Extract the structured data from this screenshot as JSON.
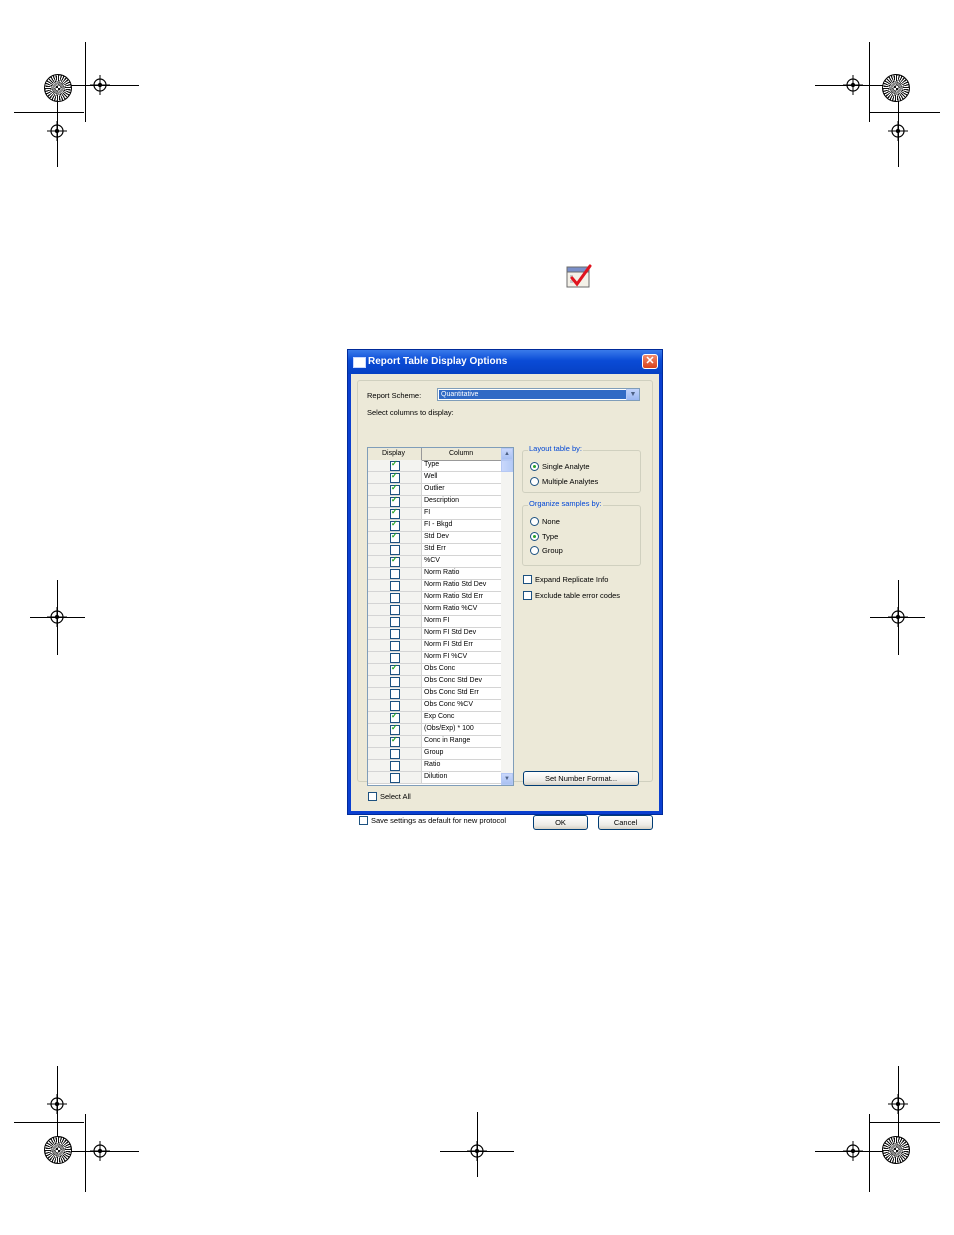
{
  "dialog": {
    "title": "Report Table Display Options",
    "report_scheme_label": "Report Scheme:",
    "report_scheme_value": "Quantitative",
    "select_columns_label": "Select columns to display:",
    "grid_headers": {
      "display": "Display",
      "column": "Column"
    },
    "columns": [
      {
        "name": "Type",
        "checked": true
      },
      {
        "name": "Well",
        "checked": true
      },
      {
        "name": "Outlier",
        "checked": true
      },
      {
        "name": "Description",
        "checked": true
      },
      {
        "name": "FI",
        "checked": true
      },
      {
        "name": "FI - Bkgd",
        "checked": true
      },
      {
        "name": "Std Dev",
        "checked": true
      },
      {
        "name": "Std Err",
        "checked": false
      },
      {
        "name": "%CV",
        "checked": true
      },
      {
        "name": "Norm Ratio",
        "checked": false
      },
      {
        "name": "Norm Ratio Std Dev",
        "checked": false
      },
      {
        "name": "Norm Ratio Std Err",
        "checked": false
      },
      {
        "name": "Norm Ratio %CV",
        "checked": false
      },
      {
        "name": "Norm FI",
        "checked": false
      },
      {
        "name": "Norm FI Std Dev",
        "checked": false
      },
      {
        "name": "Norm FI Std Err",
        "checked": false
      },
      {
        "name": "Norm FI %CV",
        "checked": false
      },
      {
        "name": "Obs Conc",
        "checked": true
      },
      {
        "name": "Obs Conc Std Dev",
        "checked": false
      },
      {
        "name": "Obs Conc Std Err",
        "checked": false
      },
      {
        "name": "Obs Conc %CV",
        "checked": false
      },
      {
        "name": "Exp Conc",
        "checked": true
      },
      {
        "name": "(Obs/Exp) * 100",
        "checked": true
      },
      {
        "name": "Conc in Range",
        "checked": true
      },
      {
        "name": "Group",
        "checked": false
      },
      {
        "name": "Ratio",
        "checked": false
      },
      {
        "name": "Dilution",
        "checked": false
      }
    ],
    "layout_group": {
      "caption": "Layout table by:",
      "options": [
        {
          "label": "Single Analyte",
          "selected": true
        },
        {
          "label": "Multiple Analytes",
          "selected": false
        }
      ]
    },
    "organize_group": {
      "caption": "Organize samples by:",
      "options": [
        {
          "label": "None",
          "selected": false
        },
        {
          "label": "Type",
          "selected": true
        },
        {
          "label": "Group",
          "selected": false
        }
      ]
    },
    "expand_replicate_label": "Expand Replicate Info",
    "exclude_error_codes_label": "Exclude table error codes",
    "set_number_format_label": "Set Number Format...",
    "select_all_label": "Select All",
    "save_default_label": "Save settings as default for new protocol",
    "ok_label": "OK",
    "cancel_label": "Cancel"
  },
  "icons": {
    "toolbar_icon": "report-table-options-icon",
    "title_icon": "window-icon",
    "close_icon": "close-icon",
    "dropdown_icon": "chevron-down-icon"
  }
}
